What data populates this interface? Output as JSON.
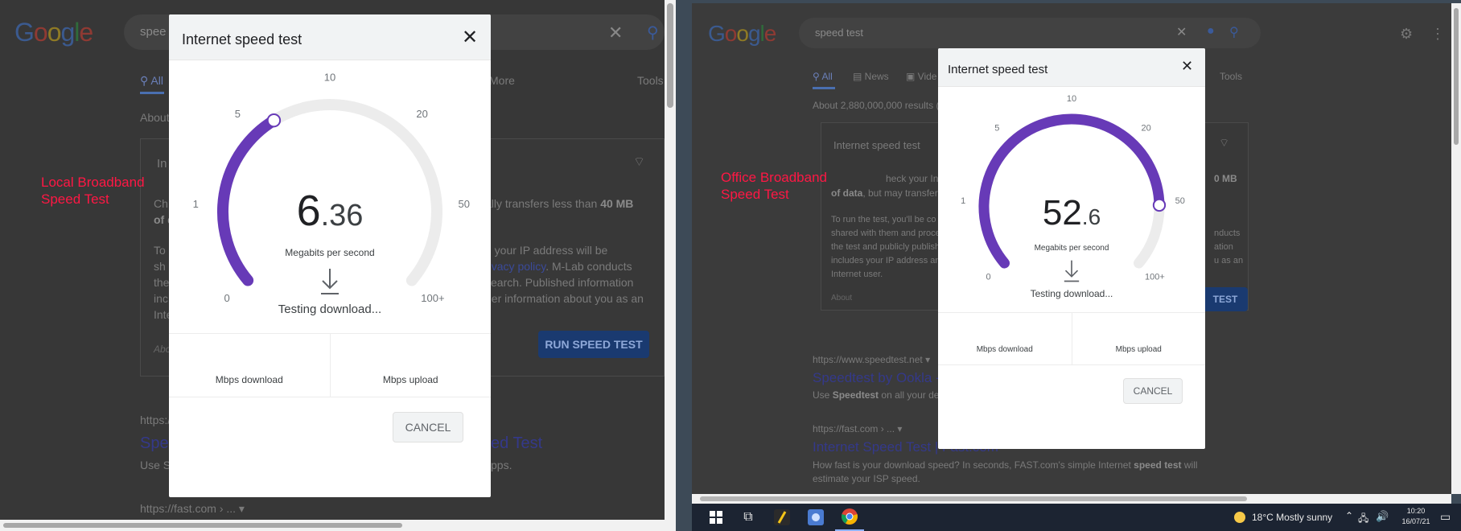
{
  "left": {
    "google_logo": [
      "G",
      "o",
      "o",
      "g",
      "l",
      "e"
    ],
    "search_query": "spee",
    "tabs": {
      "all": "All",
      "more": "More",
      "tools": "Tools"
    },
    "about_text": "About",
    "card_title": "In",
    "desc_line1_start": "Ch",
    "desc_line1_end": "ally transfers less than",
    "desc_line1_bold": "40 MB",
    "desc_line2": "of d",
    "para2": [
      "To",
      "sh",
      "the",
      "inc",
      "Inte"
    ],
    "para2_right": [
      "d your IP address will be",
      "rivacy policy. M-Lab conducts",
      "search. Published information",
      "her information about you as an"
    ],
    "privacy_link": "rivacy policy",
    "abo": "Abo",
    "run_button": "RUN SPEED TEST",
    "result_url1": "https:/",
    "result_title1_start": "Spe",
    "result_title1_end": "ed Test",
    "result_snip1_start": "Use S",
    "result_snip1_end": "pps.",
    "result_url2": "https://fast.com › ...",
    "overlay_label": [
      "Local Broadband",
      "Speed Test"
    ],
    "modal": {
      "title": "Internet speed test",
      "ticks": [
        "0",
        "1",
        "5",
        "10",
        "20",
        "50",
        "100+"
      ],
      "speed_int": "6",
      "speed_dec": ".36",
      "unit": "Megabits per second",
      "status": "Testing download...",
      "download_label": "Mbps download",
      "upload_label": "Mbps upload",
      "cancel": "CANCEL"
    },
    "gauge_value_mbps": 6.36
  },
  "right": {
    "google_logo": [
      "G",
      "o",
      "o",
      "g",
      "l",
      "e"
    ],
    "search_query": "speed test",
    "tabs": {
      "all": "All",
      "news": "News",
      "video": "Vide",
      "tools": "Tools"
    },
    "results_count": "About 2,880,000,000 results (0",
    "card_title": "Internet speed test",
    "card_desc_start": "heck your Internet speed",
    "card_desc_bold_end": "0 MB",
    "of_data": "of data",
    "card_desc_2": ", but may transfer m",
    "para": [
      "To run the test, you'll be co",
      "shared with them and proce",
      "the test and publicly publish",
      "includes your IP address an",
      "Internet user."
    ],
    "para_right": [
      "nducts",
      "ation",
      "u as an"
    ],
    "about": "About",
    "run_frag": "TEST",
    "result1_url": "https://www.speedtest.net",
    "result1_title": "Speedtest by Ookla -",
    "result1_snip_bold": "Speedtest",
    "result1_snip": "Use",
    "result1_snip_end": "on all your dev",
    "result2_url": "https://fast.com › ...",
    "result2_title": "Internet Speed Test | Fast.com",
    "result2_snip": "How fast is your download speed? In seconds, FAST.com's simple Internet",
    "result2_snip_bold": "speed test",
    "result2_snip_end": "will",
    "result2_snip2": "estimate your ISP speed.",
    "overlay_label": [
      "Office Broadband",
      "Speed Test"
    ],
    "modal": {
      "title": "Internet speed test",
      "ticks": [
        "0",
        "1",
        "5",
        "10",
        "20",
        "50",
        "100+"
      ],
      "speed_int": "52",
      "speed_dec": ".6",
      "unit": "Megabits per second",
      "status": "Testing download...",
      "download_label": "Mbps download",
      "upload_label": "Mbps upload",
      "cancel": "CANCEL"
    },
    "gauge_value_mbps": 52.6
  },
  "taskbar": {
    "weather": "18°C  Mostly sunny",
    "time": "10:20",
    "date": "16/07/21"
  },
  "colors": {
    "gauge_fill": "#673ab7",
    "gauge_track": "#ececec",
    "overlay_label": "#ff1744"
  }
}
